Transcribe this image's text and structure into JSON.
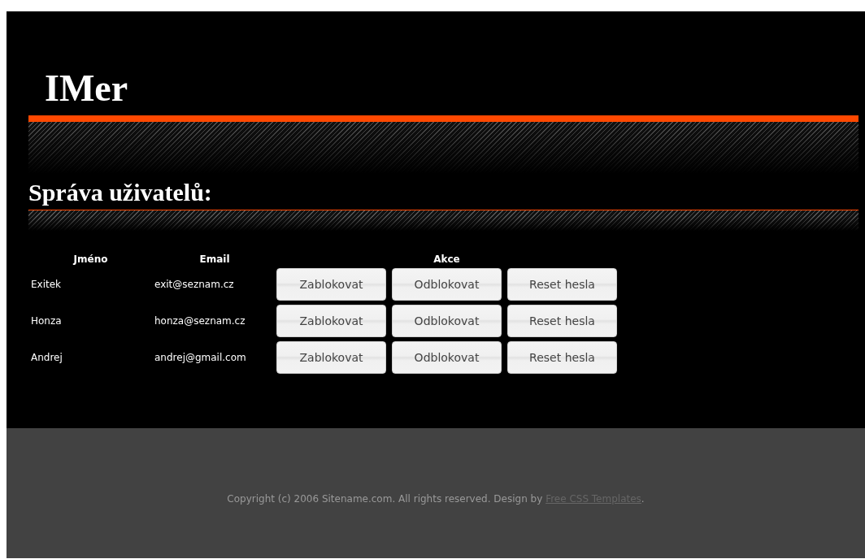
{
  "site_title": "IMer",
  "heading": "Správa uživatelů:",
  "table": {
    "columns": [
      "Jméno",
      "Email",
      "Akce"
    ],
    "rows": [
      {
        "name": "Exitek",
        "email": "exit@seznam.cz",
        "actions": [
          "Zablokovat",
          "Odblokovat",
          "Reset hesla"
        ]
      },
      {
        "name": "Honza",
        "email": "honza@seznam.cz",
        "actions": [
          "Zablokovat",
          "Odblokovat",
          "Reset hesla"
        ]
      },
      {
        "name": "Andrej",
        "email": "andrej@gmail.com",
        "actions": [
          "Zablokovat",
          "Odblokovat",
          "Reset hesla"
        ]
      }
    ]
  },
  "footer": {
    "text": "Copyright (c) 2006 Sitename.com. All rights reserved. Design by ",
    "link": "Free CSS Templates",
    "end": "."
  }
}
